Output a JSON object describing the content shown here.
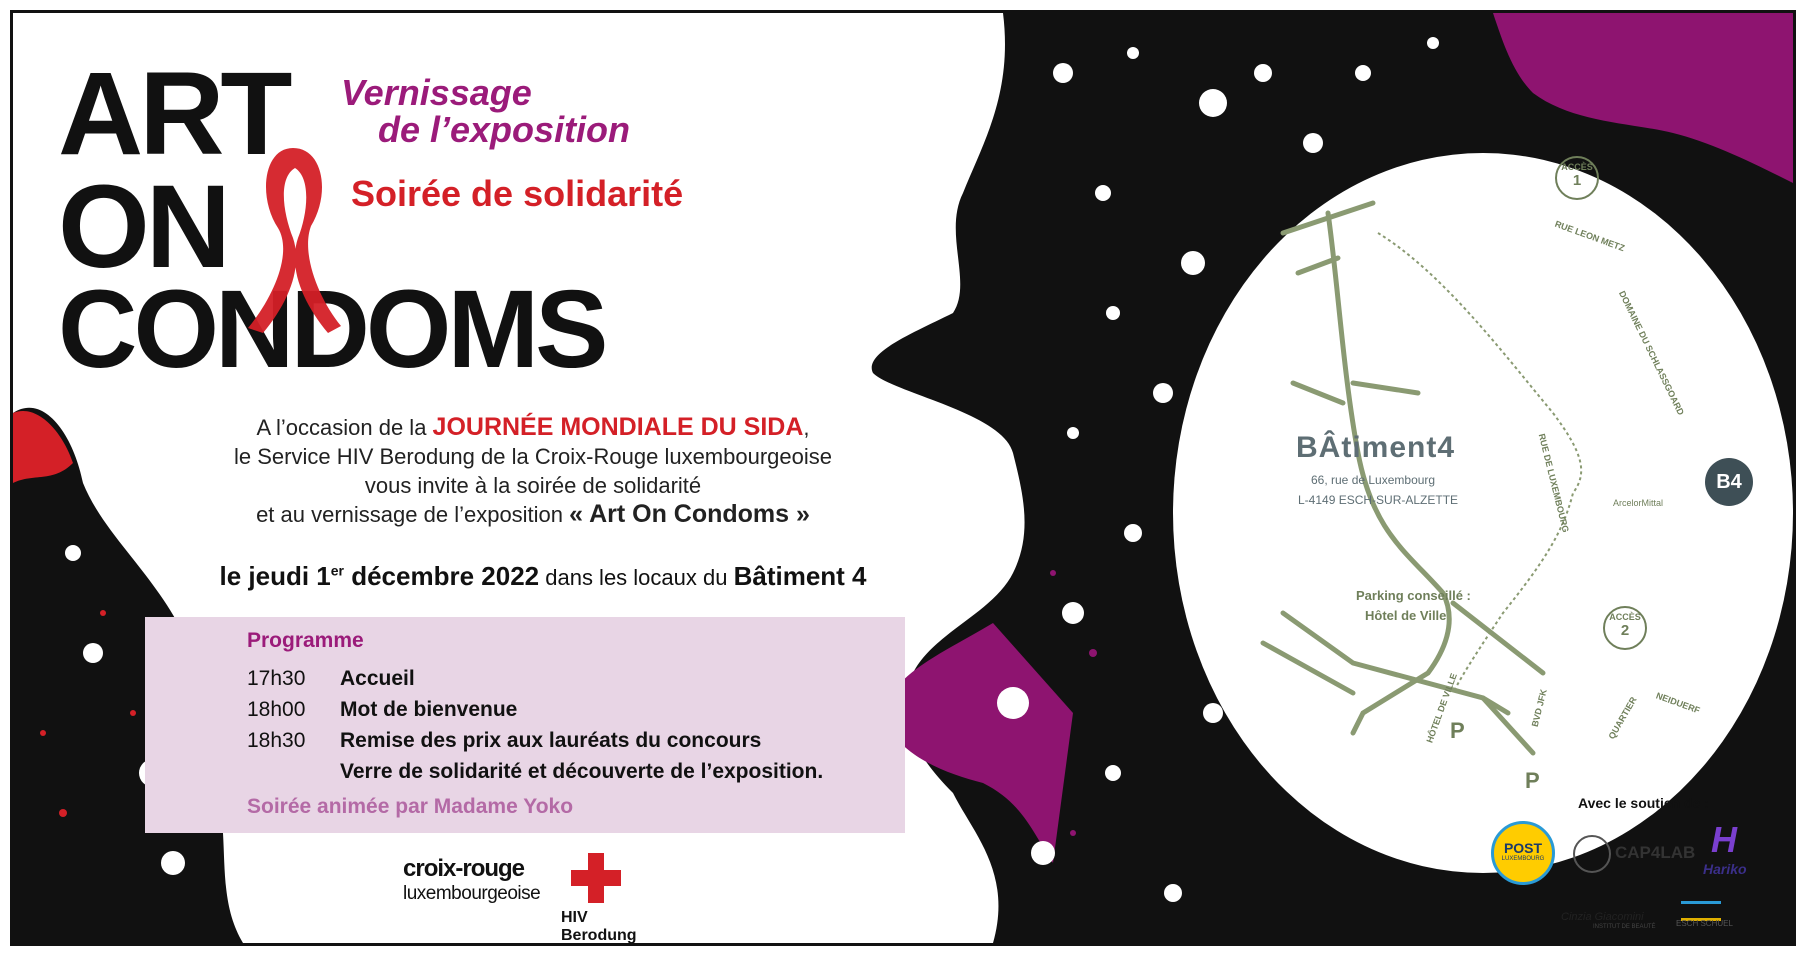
{
  "poster": {
    "title_lines": [
      "ART",
      "ON",
      "CONDOMS"
    ],
    "subtitle1_line1": "Vernissage",
    "subtitle1_line2": "de l’exposition",
    "subtitle2": "Soirée de solidarité"
  },
  "invitation": {
    "line1_prefix": "A l’occasion de la ",
    "line1_highlight": "JOURNÉE MONDIALE DU SIDA",
    "line1_suffix": ",",
    "line2": "le Service HIV Berodung de la Croix-Rouge luxembourgeoise",
    "line3": "vous invite à la soirée de solidarité",
    "line4_prefix": "et au vernissage de l’exposition ",
    "line4_highlight": "« Art On Condoms »"
  },
  "date_line": {
    "part1": "le jeudi 1",
    "sup": "er",
    "part2": " décembre 2022",
    "part3": " dans les locaux du ",
    "part4": "Bâtiment 4"
  },
  "programme": {
    "heading": "Programme",
    "items": [
      {
        "time": "17h30",
        "label": "Accueil"
      },
      {
        "time": "18h00",
        "label": "Mot de bienvenue"
      },
      {
        "time": "18h30",
        "label": "Remise des prix aux lauréats du concours"
      },
      {
        "time": "",
        "label": "Verre de solidarité et découverte de l’exposition."
      }
    ],
    "footer": "Soirée animée par Madame Yoko"
  },
  "croix_rouge": {
    "line1": "croix-rouge",
    "line2": "luxembourgeoise",
    "sub": "HIV Berodung"
  },
  "map": {
    "venue_name": "BÂtiment4",
    "address1": "66, rue de Luxembourg",
    "address2": "L-4149 ESCH-SUR-ALZETTE",
    "parking_label1": "Parking conseillé :",
    "parking_label2": "Hôtel de Ville",
    "acces1_label": "ACCÈS",
    "acces1_num": "1",
    "acces2_label": "ACCÈS",
    "acces2_num": "2",
    "streets": {
      "leon_metz": "RUE LEON METZ",
      "schlassgoard": "DOMAINE DU SCHLASSGOARD",
      "luxembourg": "RUE DE LUXEMBOURG",
      "arcelor": "ArcelorMittal",
      "hotel_ville": "HÔTEL DE VILLE",
      "bvd_jfk": "BVD JFK",
      "quartier": "QUARTIER",
      "neiduerf": "NEIDUERF"
    },
    "parking_p": "P",
    "b4_badge": "B4"
  },
  "sponsors": {
    "heading": "Avec le soutien de :",
    "post": "POST",
    "post_sub": "LUXEMBOURG",
    "cap4lab": "CAP4LAB",
    "hariko": "Hariko",
    "cinzia": "Cinzia Giacomini",
    "cinzia_sub": "INSTITUT DE BEAUTÉ",
    "esch": "ESCH SCHUEL"
  },
  "colors": {
    "magenta": "#9b1b7a",
    "red": "#d42027",
    "programme_bg": "#e8d5e5",
    "map_green": "#6f7f5a"
  }
}
